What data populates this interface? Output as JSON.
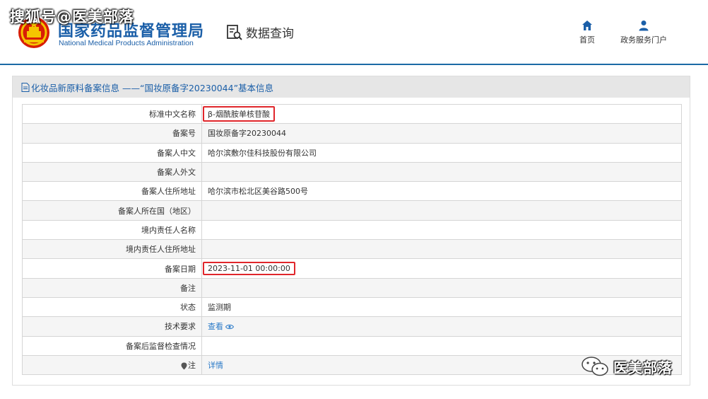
{
  "watermark": {
    "top": "搜狐号@医美部落",
    "bottom": "医美部落"
  },
  "header": {
    "org_name_cn": "国家药品监督管理局",
    "org_name_en": "National Medical Products Administration",
    "section_title": "数据查询",
    "nav": [
      {
        "label": "首页",
        "icon": "home-icon"
      },
      {
        "label": "政务服务门户",
        "icon": "user-icon"
      }
    ]
  },
  "panel": {
    "title": "化妆品新原料备案信息 ——“国妆原备字20230044”基本信息",
    "rows": [
      {
        "label": "标准中文名称",
        "value": "β-烟酰胺单核苷酸",
        "highlight": true
      },
      {
        "label": "备案号",
        "value": "国妆原备字20230044"
      },
      {
        "label": "备案人中文",
        "value": "哈尔滨敷尔佳科技股份有限公司"
      },
      {
        "label": "备案人外文",
        "value": ""
      },
      {
        "label": "备案人住所地址",
        "value": "哈尔滨市松北区美谷路500号"
      },
      {
        "label": "备案人所在国（地区）",
        "value": ""
      },
      {
        "label": "境内责任人名称",
        "value": ""
      },
      {
        "label": "境内责任人住所地址",
        "value": ""
      },
      {
        "label": "备案日期",
        "value": "2023-11-01 00:00:00",
        "highlight": true
      },
      {
        "label": "备注",
        "value": ""
      },
      {
        "label": "状态",
        "value": "监测期"
      },
      {
        "label": "技术要求",
        "value": "查看",
        "link": true,
        "icon": "eye-icon"
      },
      {
        "label": "备案后监督检查情况",
        "value": ""
      },
      {
        "label": "注",
        "value": "详情",
        "link": true,
        "label_icon": "pin-icon"
      }
    ]
  },
  "colors": {
    "brand_blue": "#1b5fa8",
    "highlight_red": "#e0262b",
    "link": "#2a7ac8"
  }
}
